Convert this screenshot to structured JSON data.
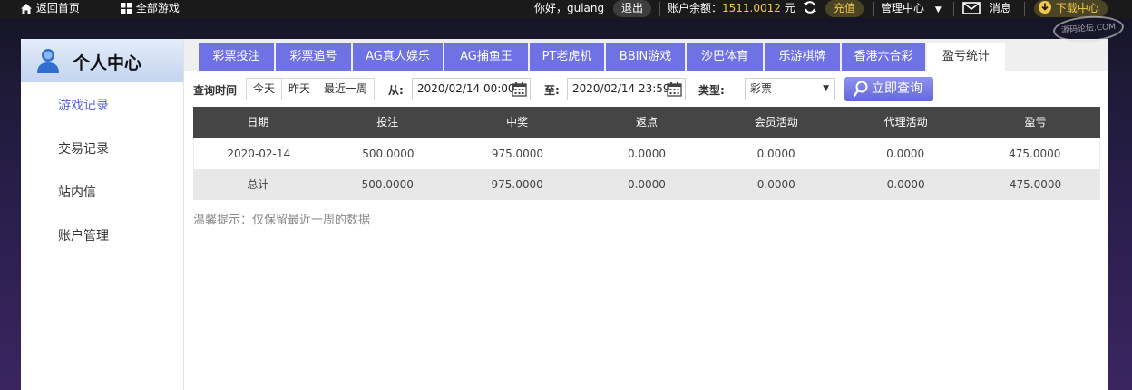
{
  "topbar": {
    "home": "返回首页",
    "all_games": "全部游戏",
    "greeting": "你好，gulang",
    "logout": "退出",
    "balance_label": "账户余额：",
    "balance_value": "1511.0012",
    "balance_unit": "元",
    "recharge": "充值",
    "admin_center": "管理中心",
    "messages": "消息",
    "download": "下载中心"
  },
  "sidebar": {
    "title": "个人中心",
    "items": [
      {
        "label": "游戏记录"
      },
      {
        "label": "交易记录"
      },
      {
        "label": "站内信"
      },
      {
        "label": "账户管理"
      }
    ]
  },
  "tabs": [
    {
      "label": "彩票投注"
    },
    {
      "label": "彩票追号"
    },
    {
      "label": "AG真人娱乐"
    },
    {
      "label": "AG捕鱼王"
    },
    {
      "label": "PT老虎机"
    },
    {
      "label": "BBIN游戏"
    },
    {
      "label": "沙巴体育"
    },
    {
      "label": "乐游棋牌"
    },
    {
      "label": "香港六合彩"
    },
    {
      "label": "盈亏统计"
    }
  ],
  "query": {
    "time_label": "查询时间",
    "quick": [
      "今天",
      "昨天",
      "最近一周"
    ],
    "from_label": "从:",
    "from_value": "2020/02/14 00:00",
    "to_label": "至:",
    "to_value": "2020/02/14 23:59",
    "type_label": "类型:",
    "type_value": "彩票",
    "search_button": "立即查询"
  },
  "table": {
    "headers": [
      "日期",
      "投注",
      "中奖",
      "返点",
      "会员活动",
      "代理活动",
      "盈亏"
    ],
    "rows": [
      [
        "2020-02-14",
        "500.0000",
        "975.0000",
        "0.0000",
        "0.0000",
        "0.0000",
        "475.0000"
      ],
      [
        "总计",
        "500.0000",
        "975.0000",
        "0.0000",
        "0.0000",
        "0.0000",
        "475.0000"
      ]
    ]
  },
  "tip": "温馨提示：仅保留最近一周的数据",
  "watermark": "源码论坛.COM",
  "colors": {
    "accent": "#6f72e4",
    "balance": "#f2c94c",
    "table_header": "#454545"
  }
}
